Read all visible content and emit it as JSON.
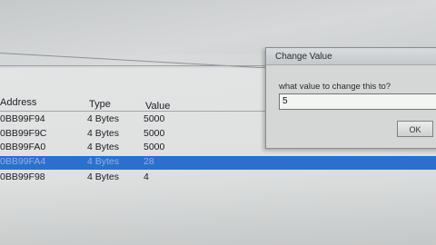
{
  "columns": {
    "address": "Address",
    "type": "Type",
    "value": "Value"
  },
  "rows": [
    {
      "address": "0BB99F94",
      "type": "4 Bytes",
      "value": "5000"
    },
    {
      "address": "0BB99F9C",
      "type": "4 Bytes",
      "value": "5000"
    },
    {
      "address": "0BB99FA0",
      "type": "4 Bytes",
      "value": "5000"
    },
    {
      "address": "0BB99FA4",
      "type": "4 Bytes",
      "value": "28"
    },
    {
      "address": "0BB99F98",
      "type": "4 Bytes",
      "value": "4"
    }
  ],
  "dialog": {
    "title": "Change Value",
    "prompt": "what value to change this to?",
    "input_value": "5",
    "ok_label": "OK"
  },
  "colors": {
    "selection": "#2d6fcc"
  }
}
